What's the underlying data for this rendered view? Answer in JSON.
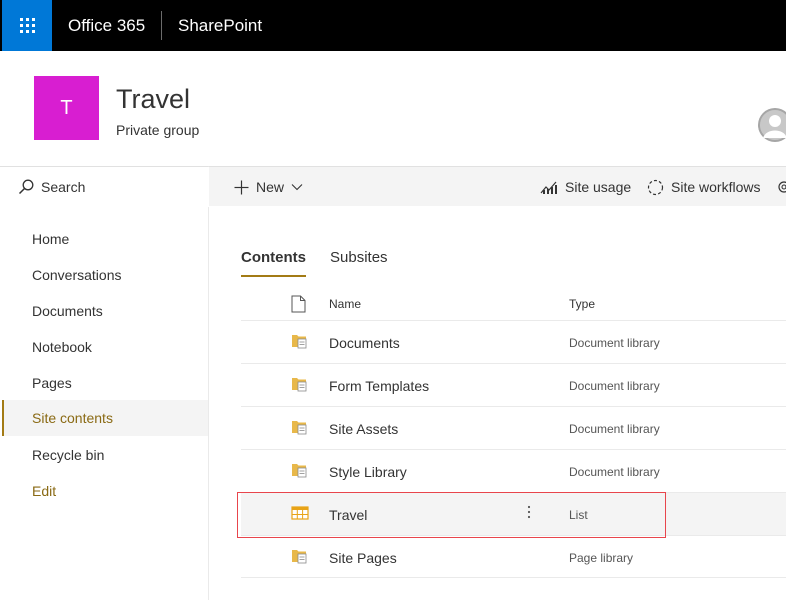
{
  "suite": {
    "product": "Office 365",
    "app": "SharePoint"
  },
  "site": {
    "logo_letter": "T",
    "logo_color": "#d81ed1",
    "title": "Travel",
    "subtitle": "Private group"
  },
  "leftnav": {
    "search_label": "Search",
    "items": [
      {
        "label": "Home"
      },
      {
        "label": "Conversations"
      },
      {
        "label": "Documents"
      },
      {
        "label": "Notebook"
      },
      {
        "label": "Pages"
      },
      {
        "label": "Site contents",
        "selected": true
      },
      {
        "label": "Recycle bin"
      }
    ],
    "edit_label": "Edit"
  },
  "commandbar": {
    "new_label": "New",
    "site_usage_label": "Site usage",
    "site_workflows_label": "Site workflows"
  },
  "tabs": [
    {
      "label": "Contents",
      "active": true
    },
    {
      "label": "Subsites",
      "active": false
    }
  ],
  "table": {
    "headers": {
      "name": "Name",
      "type": "Type"
    },
    "rows": [
      {
        "name": "Documents",
        "type": "Document library",
        "icon": "document-library-icon"
      },
      {
        "name": "Form Templates",
        "type": "Document library",
        "icon": "document-library-icon"
      },
      {
        "name": "Site Assets",
        "type": "Document library",
        "icon": "document-library-icon"
      },
      {
        "name": "Style Library",
        "type": "Document library",
        "icon": "document-library-icon"
      },
      {
        "name": "Travel",
        "type": "List",
        "icon": "list-icon",
        "highlighted": true
      },
      {
        "name": "Site Pages",
        "type": "Page library",
        "icon": "document-library-icon"
      }
    ]
  },
  "colors": {
    "accent": "#a37b15",
    "suite_bar": "#000000",
    "waffle": "#0078d7",
    "highlight_box": "#e8454c"
  }
}
